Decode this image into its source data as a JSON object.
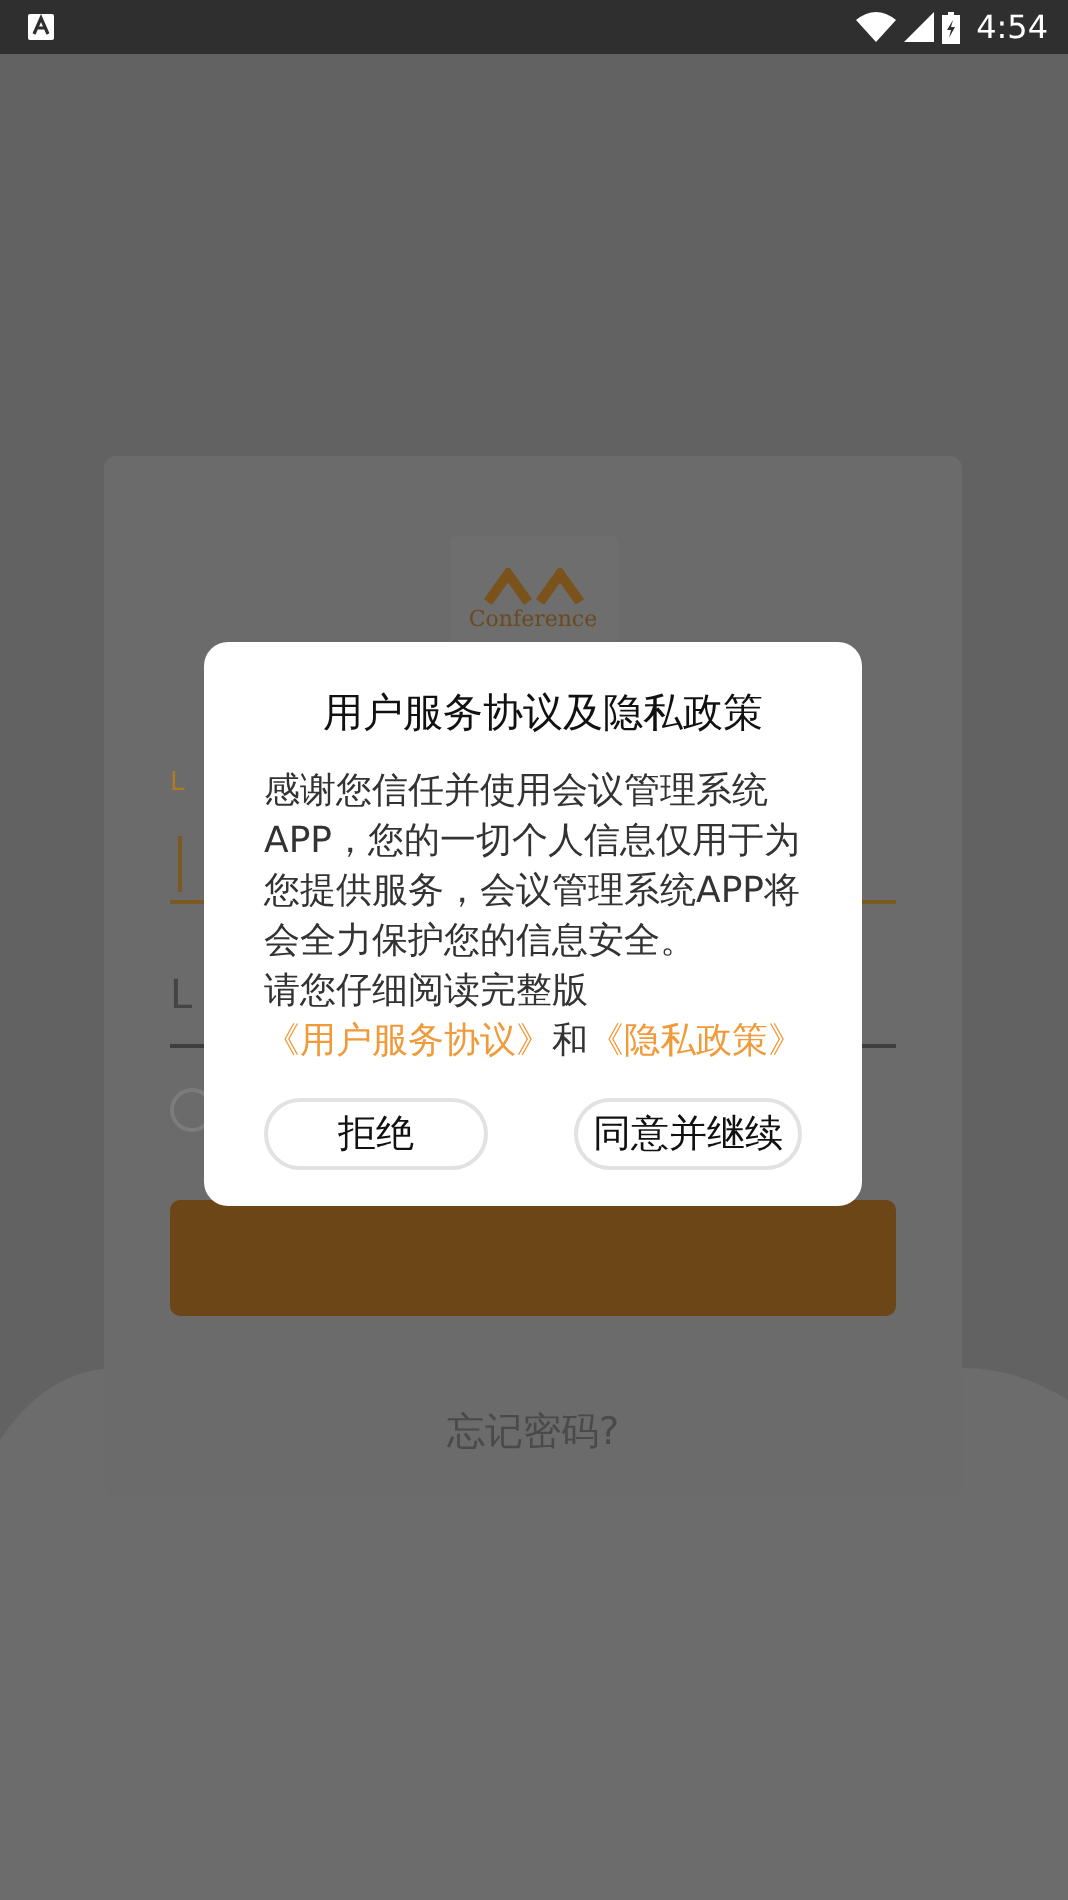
{
  "status_bar": {
    "time": "4:54"
  },
  "login_card": {
    "logo_text": "Conference",
    "account_label": "L",
    "password_placeholder": "L",
    "forgot_password": "忘记密码?",
    "remember_checked": false
  },
  "dialog": {
    "title": "用户服务协议及隐私政策",
    "body": "感谢您信任并使用会议管理系统APP，您的一切个人信息仅用于为您提供服务，会议管理系统APP将会全力保护您的信息安全。",
    "notice": "请您仔细阅读完整版",
    "links": [
      "《用户服务协议》",
      "《隐私政策》"
    ],
    "connector": "和",
    "buttons": [
      {
        "label": "拒绝"
      },
      {
        "label": "同意并继续"
      }
    ]
  }
}
